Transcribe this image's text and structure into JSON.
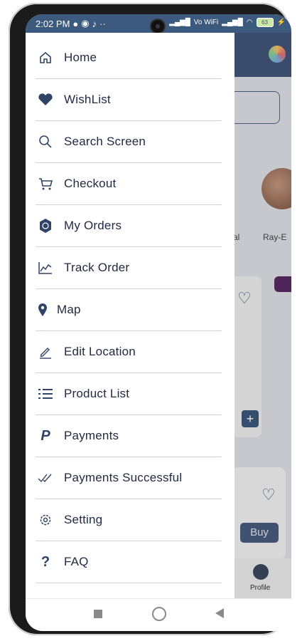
{
  "status_bar": {
    "time": "2:02 PM",
    "network": "Vo WiFi",
    "battery": "63"
  },
  "background": {
    "partial_text_left": "al",
    "partial_text_right": "Ray-E",
    "buy_button": "Buy",
    "profile_label": "Profile"
  },
  "menu": {
    "items": [
      {
        "label": "Home",
        "icon": "home-icon"
      },
      {
        "label": "WishList",
        "icon": "heart-icon"
      },
      {
        "label": "Search Screen",
        "icon": "search-icon"
      },
      {
        "label": "Checkout",
        "icon": "cart-icon"
      },
      {
        "label": "My Orders",
        "icon": "orders-icon"
      },
      {
        "label": "Track Order",
        "icon": "chart-icon"
      },
      {
        "label": "Map",
        "icon": "map-pin-icon"
      },
      {
        "label": "Edit Location",
        "icon": "pencil-icon"
      },
      {
        "label": "Product List",
        "icon": "list-icon"
      },
      {
        "label": "Payments",
        "icon": "paypal-icon"
      },
      {
        "label": "Payments Successful",
        "icon": "double-check-icon"
      },
      {
        "label": "Setting",
        "icon": "gear-icon"
      },
      {
        "label": "FAQ",
        "icon": "question-icon"
      }
    ]
  },
  "colors": {
    "accent": "#3c5a7e",
    "text": "#1f2940"
  }
}
